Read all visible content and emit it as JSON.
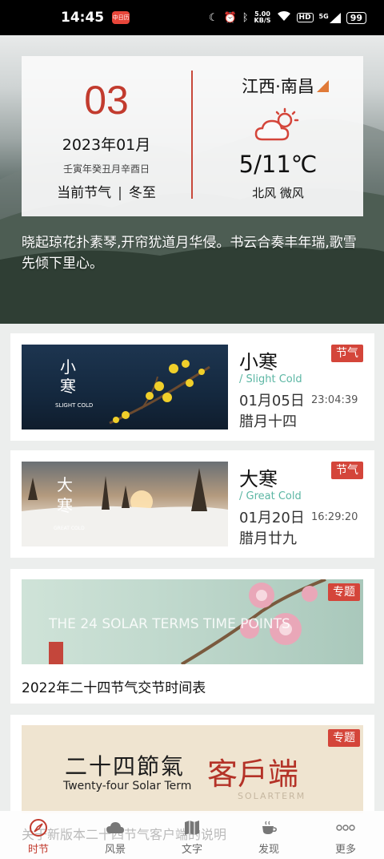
{
  "status_bar": {
    "time": "14:45",
    "app_icon_text": "中日历",
    "speed_value": "5.00",
    "speed_unit": "KB/S",
    "hd": "HD",
    "network": "5G",
    "battery": "99"
  },
  "hero": {
    "day": "03",
    "year_month": "2023年01月",
    "lunar_date": "壬寅年癸丑月辛酉日",
    "term_label": "当前节气",
    "term_sep": "|",
    "current_term": "冬至",
    "city": "江西·南昌",
    "weather_icon": "partly-cloudy-icon",
    "temperature": "5/11℃",
    "wind": "北风 微风",
    "poem": "晓起琼花扑素琴,开帘犹道月华侵。书云合奏丰年瑞,歌雪先倾下里心。",
    "colors": {
      "accent": "#c23b2e",
      "location_arrow": "#e07a38"
    }
  },
  "terms": [
    {
      "name": "小寒",
      "english": "/ Slight Cold",
      "date": "01月05日",
      "time": "23:04:39",
      "lunar": "腊月十四",
      "tag": "节气",
      "image_caption_cn": "小寒",
      "image_caption_en": "SLIGHT COLD"
    },
    {
      "name": "大寒",
      "english": "/ Great Cold",
      "date": "01月20日",
      "time": "16:29:20",
      "lunar": "腊月廿九",
      "tag": "节气",
      "image_caption_cn": "大寒",
      "image_caption_en": "GREAT COLD"
    }
  ],
  "topics": [
    {
      "tag": "专题",
      "image_text": "THE 24 SOLAR TERMS TIME POINTS",
      "title": "2022年二十四节气交节时间表"
    },
    {
      "tag": "专题",
      "image_text_cn": "二十四節氣",
      "image_text_en": "Twenty-four Solar Term",
      "image_text_client": "客戶端",
      "image_text_solarterm": "SOLARTERM"
    }
  ],
  "overlay_text": "关于新版本二十四节气客户端的说明",
  "bottom_nav": [
    {
      "label": "时节",
      "icon": "compass-icon",
      "active": true
    },
    {
      "label": "风景",
      "icon": "cloud-icon",
      "active": false
    },
    {
      "label": "文字",
      "icon": "map-book-icon",
      "active": false
    },
    {
      "label": "发现",
      "icon": "tea-cup-icon",
      "active": false
    },
    {
      "label": "更多",
      "icon": "more-dots-icon",
      "active": false
    }
  ]
}
